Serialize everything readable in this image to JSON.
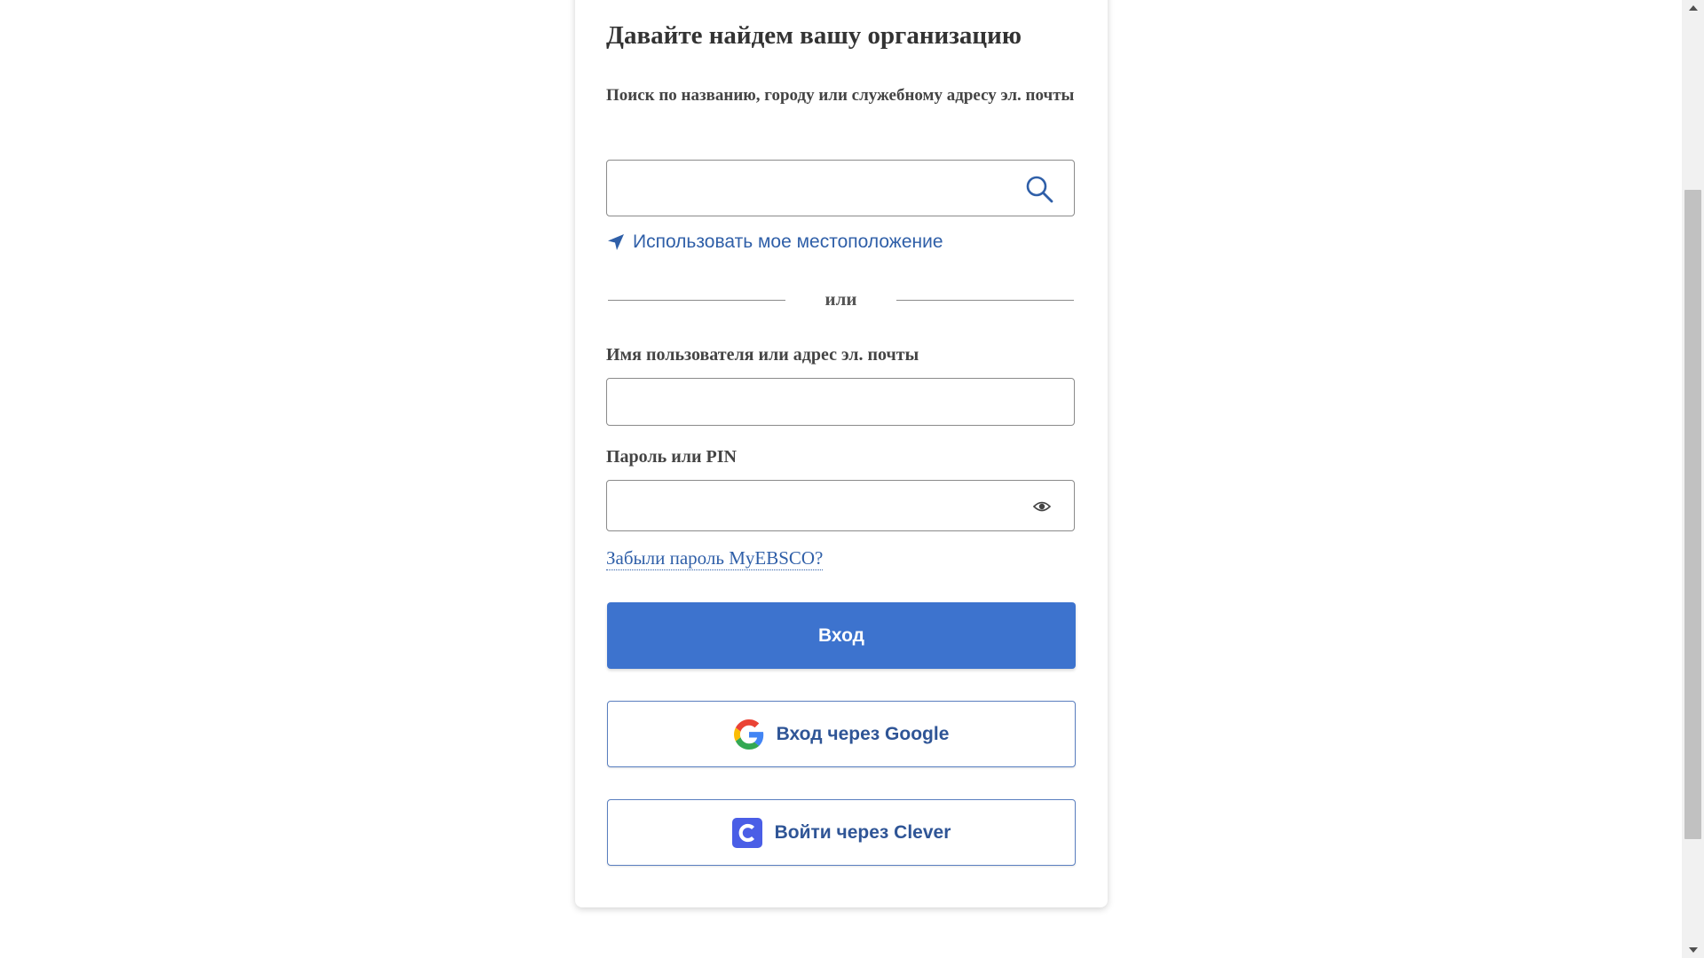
{
  "org_search": {
    "heading": "Давайте найдем вашу организацию",
    "label": "Поиск по названию, городу или служебному адресу эл. почты",
    "value": "",
    "location_link": "Использовать мое местоположение"
  },
  "divider": "или",
  "login": {
    "username_label": "Имя пользователя или адрес эл. почты",
    "username_value": "",
    "password_label": "Пароль или PIN",
    "password_value": "",
    "forgot_link": "Забыли пароль MyEBSCO?",
    "submit_label": "Вход",
    "google_label": "Вход через Google",
    "clever_label": "Войти через Clever"
  },
  "icons": {
    "search": "search-icon",
    "location": "location-arrow-icon",
    "eye": "eye-icon",
    "google": "google-logo-icon",
    "clever": "clever-logo-icon"
  },
  "colors": {
    "primary": "#3d73ce",
    "link": "#2f5fa8",
    "outline_text": "#2f5596",
    "clever": "#4a5ee6"
  }
}
